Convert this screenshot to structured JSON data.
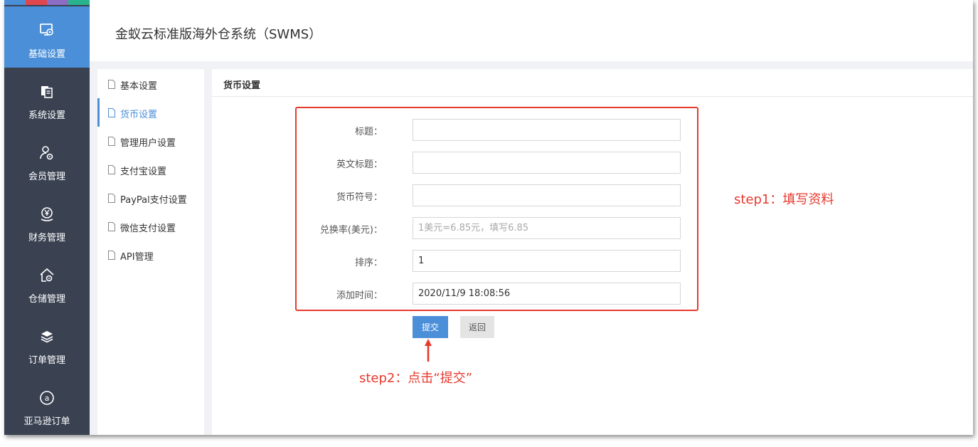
{
  "colors": {
    "sidebar_bg": "#3a4252",
    "accent": "#4b8fd8",
    "annotation": "#e63a2e",
    "strip": [
      "#4b8fd8",
      "#e0474c",
      "#8d6cc3",
      "#29b38c"
    ]
  },
  "header": {
    "title": "金蚁云标准版海外仓系统（SWMS）"
  },
  "sidebar": {
    "items": [
      {
        "label": "基础设置",
        "icon": "monitor-gear-icon",
        "active": true
      },
      {
        "label": "系统设置",
        "icon": "documents-icon",
        "active": false
      },
      {
        "label": "会员管理",
        "icon": "user-gear-icon",
        "active": false
      },
      {
        "label": "财务管理",
        "icon": "yen-hand-icon",
        "active": false
      },
      {
        "label": "仓储管理",
        "icon": "warehouse-gear-icon",
        "active": false
      },
      {
        "label": "订单管理",
        "icon": "layers-icon",
        "active": false
      },
      {
        "label": "亚马逊订单",
        "icon": "amazon-icon",
        "active": false
      }
    ]
  },
  "submenu": {
    "items": [
      {
        "label": "基本设置",
        "active": false
      },
      {
        "label": "货币设置",
        "active": true
      },
      {
        "label": "管理用户设置",
        "active": false
      },
      {
        "label": "支付宝设置",
        "active": false
      },
      {
        "label": "PayPal支付设置",
        "active": false
      },
      {
        "label": "微信支付设置",
        "active": false
      },
      {
        "label": "API管理",
        "active": false
      }
    ]
  },
  "panel": {
    "title": "货币设置",
    "fields": [
      {
        "label": "标题：",
        "value": "",
        "placeholder": ""
      },
      {
        "label": "英文标题：",
        "value": "",
        "placeholder": ""
      },
      {
        "label": "货币符号：",
        "value": "",
        "placeholder": ""
      },
      {
        "label": "兑换率(美元)：",
        "value": "",
        "placeholder": "1美元=6.85元，填写6.85"
      },
      {
        "label": "排序：",
        "value": "1",
        "placeholder": ""
      },
      {
        "label": "添加时间：",
        "value": "2020/11/9 18:08:56",
        "placeholder": ""
      }
    ],
    "submit_label": "提交",
    "back_label": "返回"
  },
  "annotations": {
    "step1": "step1：填写资料",
    "step2": "step2：点击“提交”"
  }
}
